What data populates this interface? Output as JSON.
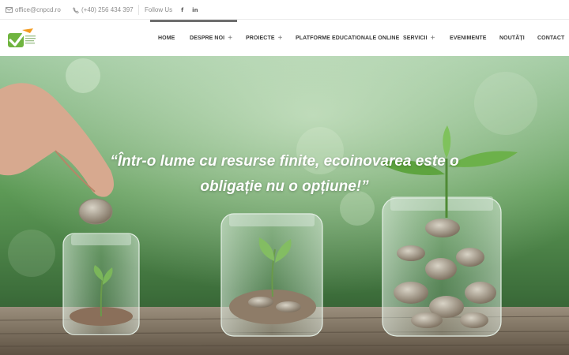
{
  "topbar": {
    "email": "office@cnpcd.ro",
    "phone": "(+40) 256 434 397",
    "follow_label": "Follow Us",
    "social": [
      {
        "icon": "facebook-icon",
        "label": "f"
      },
      {
        "icon": "linkedin-icon",
        "label": "in"
      }
    ]
  },
  "nav": {
    "items": [
      {
        "label": "HOME",
        "has_submenu": false
      },
      {
        "label": "DESPRE NOI",
        "has_submenu": true
      },
      {
        "label": "PROIECTE",
        "has_submenu": true
      },
      {
        "label": "PLATFORME EDUCATIONALE ONLINE",
        "has_submenu": false
      },
      {
        "label": "SERVICII",
        "has_submenu": true
      },
      {
        "label": "EVENIMENTE",
        "has_submenu": false
      },
      {
        "label": "NOUTĂȚI",
        "has_submenu": false
      },
      {
        "label": "CONTACT",
        "has_submenu": false
      }
    ],
    "submenu_symbol": "+"
  },
  "hero": {
    "quote_line1": "“Într-o lume cu resurse finite, ecoinovarea este o",
    "quote_line2": "obligație nu o opțiune!”"
  },
  "colors": {
    "logo_green": "#6fb43f",
    "logo_orange": "#f39a1d",
    "hero_green": "#5e9a4a"
  }
}
